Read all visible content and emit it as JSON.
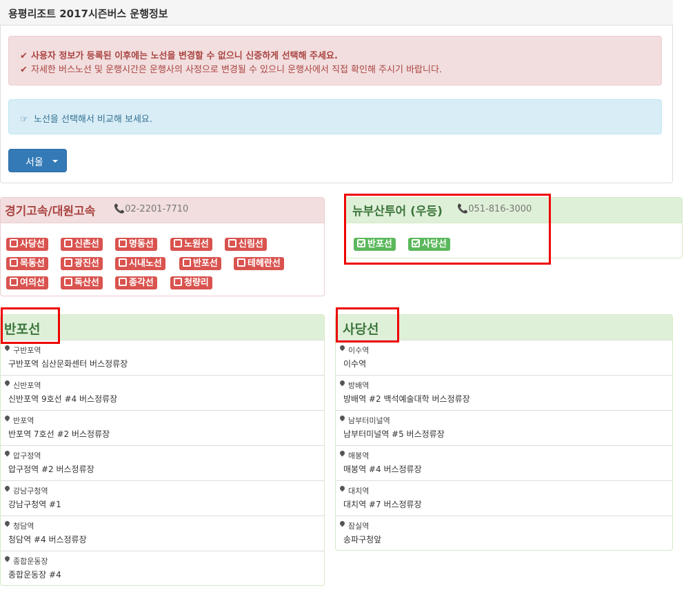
{
  "page": {
    "title": "용평리조트 2017시즌버스 운행정보"
  },
  "alerts": {
    "danger": [
      "사용자 정보가 등록된 이후에는 노선을 변경할 수 없으니 신중하게 선택해 주세요.",
      "자세한 버스노선 및 운행시간은 운행사의 사정으로 변경될 수 있으니 운행사에서 직접 확인해 주시기 바랍니다."
    ],
    "info": "노선을 선택해서 비교해 보세요."
  },
  "region_dropdown": {
    "label": "서울"
  },
  "companies": [
    {
      "name": "경기고속/대원고속",
      "phone": "02-2201-7710",
      "routes": [
        "사당선",
        "신촌선",
        "명동선",
        "노원선",
        "신림선",
        "목동선",
        "광진선",
        "시내노선",
        "반포선",
        "테헤란선",
        "여의선",
        "독산선",
        "종각선",
        "청량리"
      ],
      "routes_checked": false
    },
    {
      "name": "뉴부산투어 (우등)",
      "phone": "051-816-3000",
      "routes": [
        "반포선",
        "사당선"
      ],
      "routes_checked": true
    }
  ],
  "route_details": [
    {
      "title": "반포선",
      "stops": [
        {
          "name": "구반포역",
          "detail": "구반포역 심산문화센터 버스정류장"
        },
        {
          "name": "신반포역",
          "detail": "신반포역 9호선 #4 버스정류장"
        },
        {
          "name": "반포역",
          "detail": "반포역 7호선 #2 버스정류장"
        },
        {
          "name": "압구정역",
          "detail": "압구정역 #2 버스정류장"
        },
        {
          "name": "강남구청역",
          "detail": "강남구청역 #1"
        },
        {
          "name": "청담역",
          "detail": "청담역 #4 버스정류장"
        },
        {
          "name": "종합운동장",
          "detail": "종합운동장 #4"
        }
      ]
    },
    {
      "title": "사당선",
      "stops": [
        {
          "name": "이수역",
          "detail": "이수역"
        },
        {
          "name": "방배역",
          "detail": "방배역 #2 백석예술대학 버스정류장"
        },
        {
          "name": "남부터미널역",
          "detail": "남부터미널역 #5 버스정류장"
        },
        {
          "name": "매봉역",
          "detail": "매봉역 #4 버스정류장"
        },
        {
          "name": "대치역",
          "detail": "대치역 #7 버스정류장"
        },
        {
          "name": "잠실역",
          "detail": "송파구청앞"
        }
      ]
    }
  ],
  "colors": {
    "danger": "#d9534f",
    "success": "#5cb85c",
    "primary": "#337ab7",
    "highlight_box": "#e00000"
  }
}
